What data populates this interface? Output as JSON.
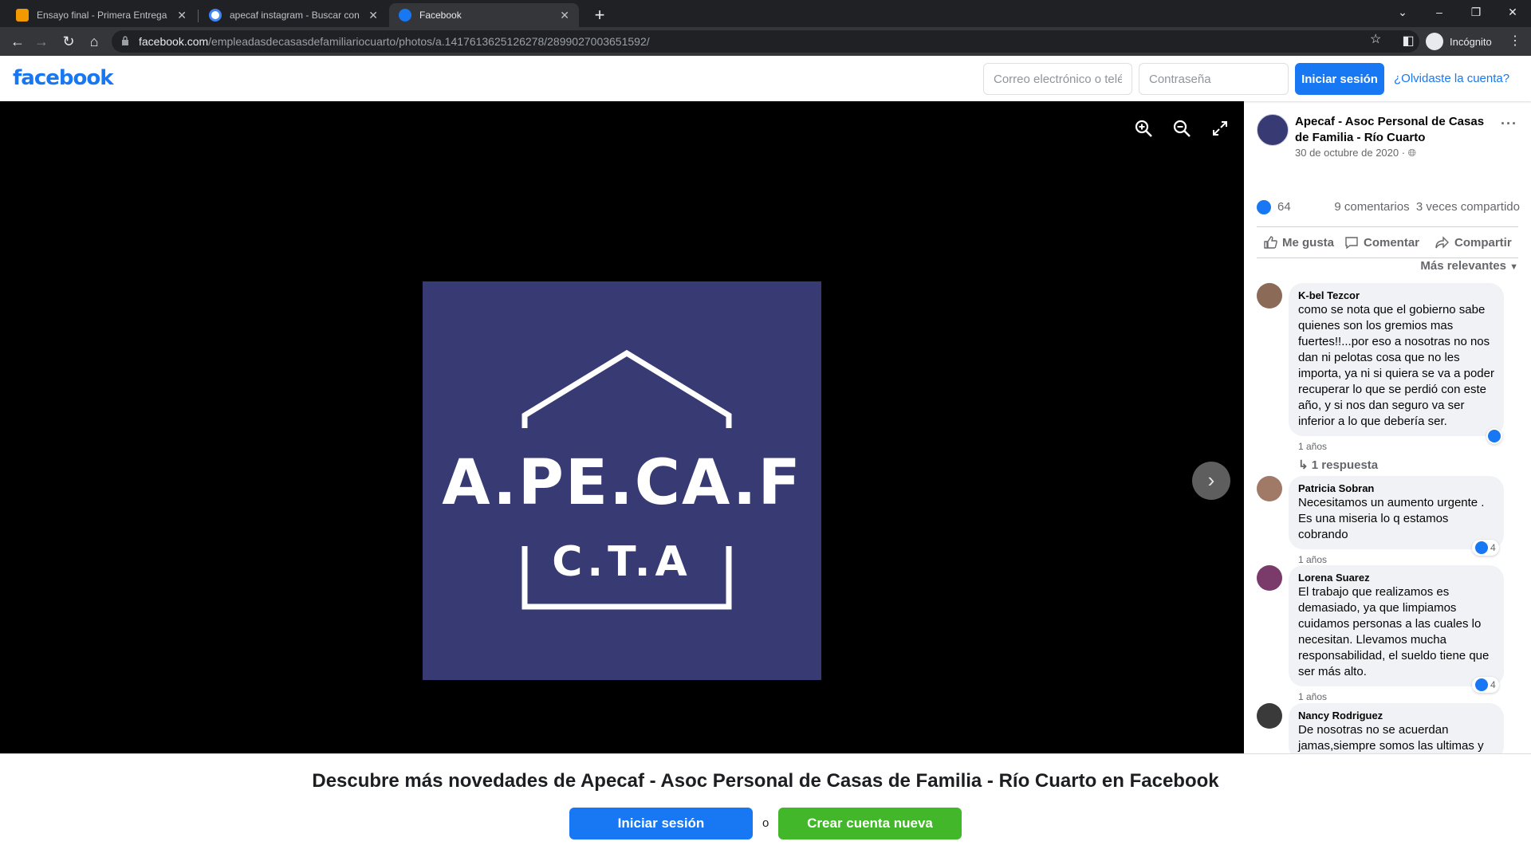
{
  "browser": {
    "tabs": [
      {
        "title": "Ensayo final - Primera Entrega",
        "favicon_color": "#f29900"
      },
      {
        "title": "apecaf instagram - Buscar con Google",
        "favicon_color": "#4285f4"
      },
      {
        "title": "Facebook",
        "favicon_color": "#1877f2"
      }
    ],
    "url_host": "facebook.com",
    "url_path": "/empleadasdecasasdefamiliariocuarto/photos/a.1417613625126278/2899027003651592/",
    "incognito_label": "Incógnito"
  },
  "header": {
    "logo": "facebook",
    "email_placeholder": "Correo electrónico o teléfono",
    "password_placeholder": "Contraseña",
    "login_label": "Iniciar sesión",
    "forgot_label": "¿Olvidaste la cuenta?"
  },
  "photo": {
    "logo_main": "A.PE.CA.F",
    "logo_sub": "C.T.A",
    "background": "#383a73"
  },
  "post": {
    "page_name": "Apecaf - Asoc Personal de Casas de Familia - Río Cuarto",
    "date": "30 de octubre de 2020 · ",
    "likes": "64",
    "comments_count": "9 comentarios",
    "shares": "3 veces compartido",
    "actions": {
      "like": "Me gusta",
      "comment": "Comentar",
      "share": "Compartir"
    },
    "sort_label": "Más relevantes"
  },
  "comments": [
    {
      "name": "K-bel Tezcor",
      "text": "como se nota que el gobierno sabe quienes son los gremios mas fuertes!!...por eso a nosotras no nos dan ni pelotas cosa que no les importa, ya ni si quiera se va a poder recuperar lo que se perdió con este año, y si nos dan seguro va ser inferior a lo que debería ser.",
      "time": "1 años",
      "reaction_count": "",
      "replies": "1 respuesta",
      "avatar_color": "#8b6b58"
    },
    {
      "name": "Patricia Sobran",
      "text": "Necesitamos un aumento urgente . Es una miseria lo q estamos cobrando",
      "time": "1 años",
      "reaction_count": "4",
      "replies": "",
      "avatar_color": "#a07a66"
    },
    {
      "name": "Lorena Suarez",
      "text": "El trabajo que realizamos es demasiado, ya que limpiamos cuidamos personas a las cuales lo necesitan. Llevamos mucha responsabilidad, el sueldo tiene que ser más alto.",
      "time": "1 años",
      "reaction_count": "4",
      "replies": "",
      "avatar_color": "#7a3a6a"
    },
    {
      "name": "Nancy Rodriguez",
      "text": "De nosotras no se acuerdan jamas,siempre somos las ultimas y",
      "time": "",
      "reaction_count": "",
      "replies": "",
      "avatar_color": "#3a3a3a"
    }
  ],
  "banner": {
    "title": "Descubre más novedades de Apecaf - Asoc Personal de Casas de Familia - Río Cuarto en Facebook",
    "login_label": "Iniciar sesión",
    "or_label": "o",
    "create_label": "Crear cuenta nueva"
  }
}
